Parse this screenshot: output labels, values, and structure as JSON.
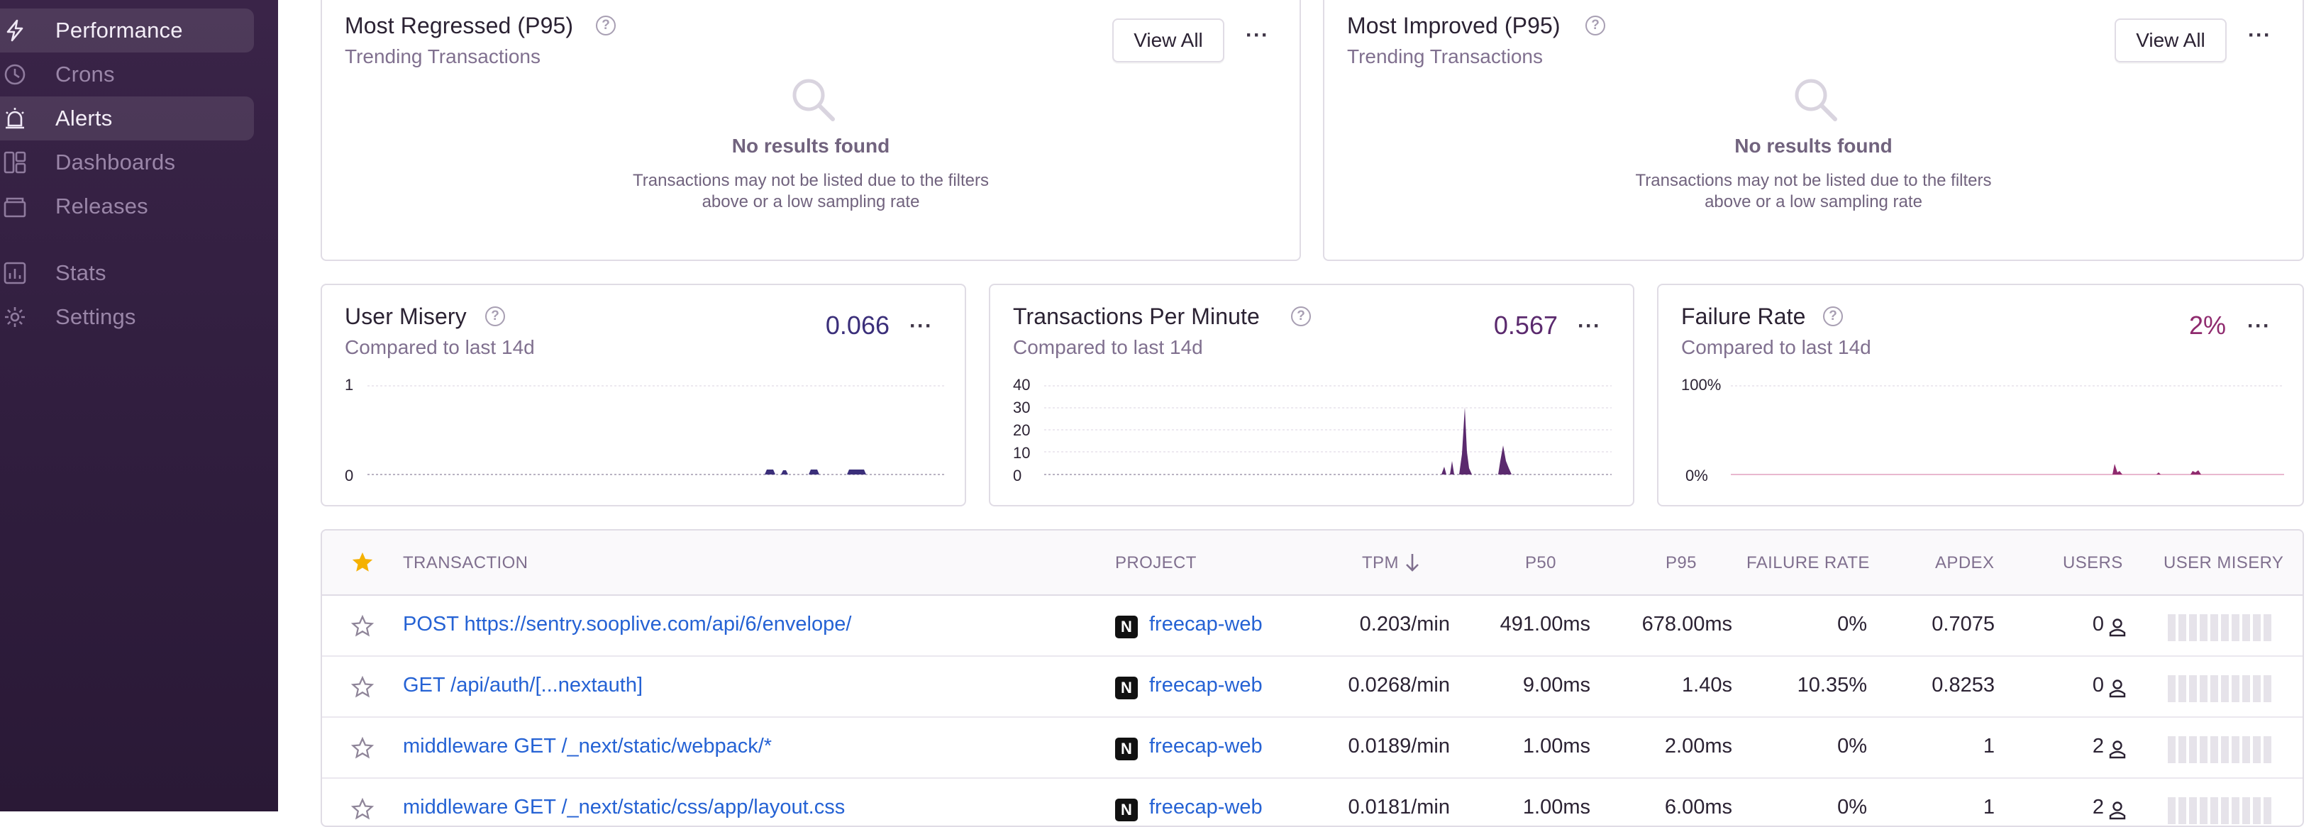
{
  "sidebar": {
    "items": [
      {
        "label": "Performance",
        "icon": "lightning-icon"
      },
      {
        "label": "Crons",
        "icon": "clock-icon"
      },
      {
        "label": "Alerts",
        "icon": "siren-icon"
      },
      {
        "label": "Dashboards",
        "icon": "dashboard-icon"
      },
      {
        "label": "Releases",
        "icon": "package-icon"
      },
      {
        "label": "Stats",
        "icon": "bar-chart-icon"
      },
      {
        "label": "Settings",
        "icon": "gear-icon"
      }
    ]
  },
  "regressed": {
    "title": "Most Regressed (P95)",
    "subtitle": "Trending Transactions",
    "view_all": "View All",
    "empty_title": "No results found",
    "empty_desc_1": "Transactions may not be listed due to the filters",
    "empty_desc_2": "above or a low sampling rate"
  },
  "improved": {
    "title": "Most Improved (P95)",
    "subtitle": "Trending Transactions",
    "view_all": "View All",
    "empty_title": "No results found",
    "empty_desc_1": "Transactions may not be listed due to the filters",
    "empty_desc_2": "above or a low sampling rate"
  },
  "widgets": {
    "misery": {
      "title": "User Misery",
      "subtitle": "Compared to last 14d",
      "value": "0.066",
      "y_top": "1",
      "y_bottom": "0",
      "color": "#3b2f7a"
    },
    "tpm": {
      "title": "Transactions Per Minute",
      "subtitle": "Compared to last 14d",
      "value": "0.567",
      "ticks": [
        "40",
        "30",
        "20",
        "10",
        "0"
      ],
      "color": "#5b2a6e"
    },
    "failure": {
      "title": "Failure Rate",
      "subtitle": "Compared to last 14d",
      "value": "2%",
      "y_top": "100%",
      "y_bottom": "0%",
      "color": "#8f2a6e"
    }
  },
  "table": {
    "headers": {
      "transaction": "TRANSACTION",
      "project": "PROJECT",
      "tpm": "TPM",
      "p50": "P50",
      "p95": "P95",
      "failure_rate": "FAILURE RATE",
      "apdex": "APDEX",
      "users": "USERS",
      "user_misery": "USER MISERY"
    },
    "rows": [
      {
        "transaction": "POST https://sentry.sooplive.com/api/6/envelope/",
        "project": "freecap-web",
        "badge": "N",
        "tpm": "0.203/min",
        "p50": "491.00ms",
        "p95": "678.00ms",
        "failure_rate": "0%",
        "apdex": "0.7075",
        "users": "0"
      },
      {
        "transaction": "GET /api/auth/[...nextauth]",
        "project": "freecap-web",
        "badge": "N",
        "tpm": "0.0268/min",
        "p50": "9.00ms",
        "p95": "1.40s",
        "failure_rate": "10.35%",
        "apdex": "0.8253",
        "users": "0"
      },
      {
        "transaction": "middleware GET /_next/static/webpack/*",
        "project": "freecap-web",
        "badge": "N",
        "tpm": "0.0189/min",
        "p50": "1.00ms",
        "p95": "2.00ms",
        "failure_rate": "0%",
        "apdex": "1",
        "users": "2"
      },
      {
        "transaction": "middleware GET /_next/static/css/app/layout.css",
        "project": "freecap-web",
        "badge": "N",
        "tpm": "0.0181/min",
        "p50": "1.00ms",
        "p95": "6.00ms",
        "failure_rate": "0%",
        "apdex": "1",
        "users": "2"
      }
    ]
  }
}
